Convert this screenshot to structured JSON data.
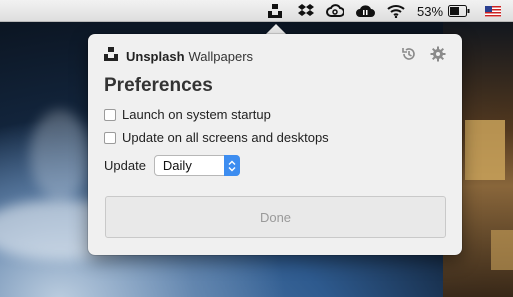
{
  "menubar": {
    "battery_percent": "53%",
    "icons": [
      "unsplash-icon",
      "dropbox-icon",
      "creative-cloud-icon",
      "cloud-sync-icon",
      "wifi-icon",
      "battery-icon",
      "us-flag-icon"
    ]
  },
  "popover": {
    "brand_name": "Unsplash",
    "brand_sub": "Wallpapers",
    "header_icons": [
      "history-icon",
      "gear-icon"
    ],
    "title": "Preferences",
    "options": [
      {
        "label": "Launch on system startup",
        "checked": false
      },
      {
        "label": "Update on all screens and desktops",
        "checked": false
      }
    ],
    "update_label": "Update",
    "update_value": "Daily",
    "done_label": "Done"
  },
  "colors": {
    "accent": "#3d8df0",
    "popover_bg": "#f0f0f0"
  }
}
